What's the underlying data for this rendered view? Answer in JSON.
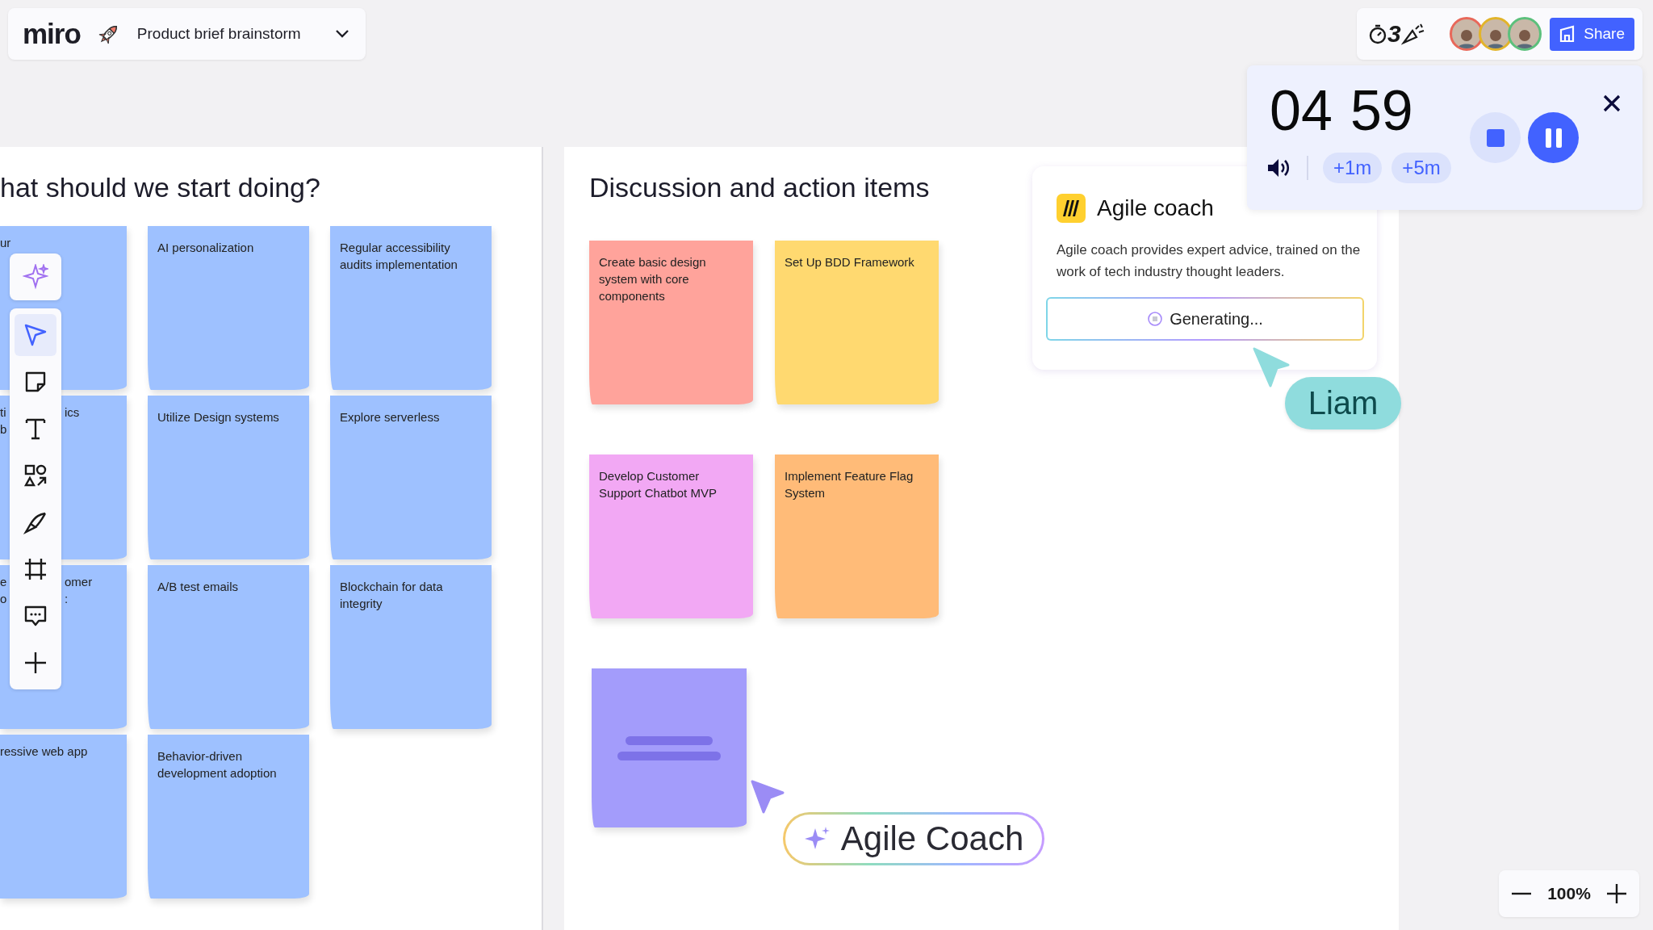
{
  "header": {
    "logo": "miro",
    "board_title": "Product brief brainstorm"
  },
  "top_right": {
    "reaction_count": "3",
    "avatars": [
      {
        "color": "#e8685a"
      },
      {
        "color": "#e2b42a"
      },
      {
        "color": "#5cc07c"
      }
    ],
    "share_button": "Share"
  },
  "timer": {
    "minutes": "04",
    "seconds": "59",
    "add_buttons": [
      "+1m",
      "+5m"
    ]
  },
  "toolbar": {
    "tools": [
      {
        "kind": "ai",
        "selected": false
      },
      {
        "kind": "select",
        "selected": true
      },
      {
        "kind": "sticky",
        "selected": false
      },
      {
        "kind": "text",
        "selected": false
      },
      {
        "kind": "shapes",
        "selected": false
      },
      {
        "kind": "pen",
        "selected": false
      },
      {
        "kind": "frame",
        "selected": false
      },
      {
        "kind": "comment",
        "selected": false
      },
      {
        "kind": "add",
        "selected": false
      }
    ]
  },
  "frames": [
    {
      "title": "hat should we start doing?",
      "stickies": [
        {
          "kind": "cut",
          "color": "#9ec1ff",
          "left_lines": [
            "ur"
          ]
        },
        {
          "kind": "note",
          "color": "#9ec1ff",
          "text": "AI personalization"
        },
        {
          "kind": "note",
          "color": "#9ec1ff",
          "text": "Regular accessibility audits implementation"
        },
        {
          "kind": "cut",
          "color": "#9ec1ff",
          "left_lines": [
            "ti",
            "b"
          ],
          "right_lines": [
            "ics"
          ]
        },
        {
          "kind": "note",
          "color": "#9ec1ff",
          "text": "Utilize Design systems"
        },
        {
          "kind": "note",
          "color": "#9ec1ff",
          "text": "Explore serverless"
        },
        {
          "kind": "cut",
          "color": "#9ec1ff",
          "left_lines": [
            "e",
            "o"
          ],
          "right_lines": [
            "omer",
            ":"
          ]
        },
        {
          "kind": "note",
          "color": "#9ec1ff",
          "text": "A/B test emails"
        },
        {
          "kind": "note",
          "color": "#9ec1ff",
          "text": "Blockchain for data integrity"
        },
        {
          "kind": "cut",
          "color": "#9ec1ff",
          "left_lines": [
            "ressive web app"
          ]
        },
        {
          "kind": "note",
          "color": "#9ec1ff",
          "text": "Behavior-driven development adoption"
        }
      ]
    },
    {
      "title": "Discussion and action items",
      "stickies": [
        {
          "kind": "note",
          "color": "#ffa39b",
          "text": "Create basic design system with core components"
        },
        {
          "kind": "note",
          "color": "#ffd970",
          "text": "Set Up BDD Framework"
        },
        {
          "kind": "note",
          "color": "#f2a8f4",
          "text": "Develop Customer Support Chatbot MVP"
        },
        {
          "kind": "note",
          "color": "#ffbb78",
          "text": "Implement Feature Flag System"
        },
        {
          "kind": "placeholder",
          "color": "#a39cfb"
        }
      ]
    }
  ],
  "agile_coach_card": {
    "title": "Agile coach",
    "description": "Agile coach provides expert advice, trained on the work of tech industry thought leaders.",
    "button": "Generating..."
  },
  "cursors": [
    {
      "kind": "user",
      "label": "Liam",
      "color": "#8fdcdd"
    },
    {
      "kind": "ai",
      "label": "Agile Coach",
      "color": "#9b8cf5"
    }
  ],
  "zoom": {
    "level_text": "100%"
  }
}
